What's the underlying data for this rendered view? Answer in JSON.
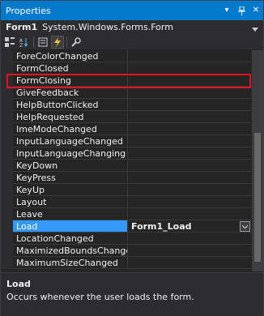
{
  "window": {
    "title": "Properties"
  },
  "objbar": {
    "name": "Form1",
    "type": "System.Windows.Forms.Form"
  },
  "toolbar": [
    "categorized-icon",
    "alphabetical-icon",
    "properties-icon",
    "events-icon",
    "property-pages-icon"
  ],
  "rows": [
    {
      "name": "ForeColorChanged",
      "value": ""
    },
    {
      "name": "FormClosed",
      "value": ""
    },
    {
      "name": "FormClosing",
      "value": ""
    },
    {
      "name": "GiveFeedback",
      "value": ""
    },
    {
      "name": "HelpButtonClicked",
      "value": ""
    },
    {
      "name": "HelpRequested",
      "value": ""
    },
    {
      "name": "ImeModeChanged",
      "value": ""
    },
    {
      "name": "InputLanguageChanged",
      "value": ""
    },
    {
      "name": "InputLanguageChanging",
      "value": ""
    },
    {
      "name": "KeyDown",
      "value": ""
    },
    {
      "name": "KeyPress",
      "value": ""
    },
    {
      "name": "KeyUp",
      "value": ""
    },
    {
      "name": "Layout",
      "value": ""
    },
    {
      "name": "Leave",
      "value": ""
    },
    {
      "name": "Load",
      "value": "Form1_Load"
    },
    {
      "name": "LocationChanged",
      "value": ""
    },
    {
      "name": "MaximizedBoundsChanged",
      "value": ""
    },
    {
      "name": "MaximumSizeChanged",
      "value": ""
    }
  ],
  "description": {
    "name": "Load",
    "text": "Occurs whenever the user loads the form."
  },
  "colors": {
    "titlebar": "#007acc",
    "selection": "#3399ff",
    "highlight": "#e81123"
  }
}
